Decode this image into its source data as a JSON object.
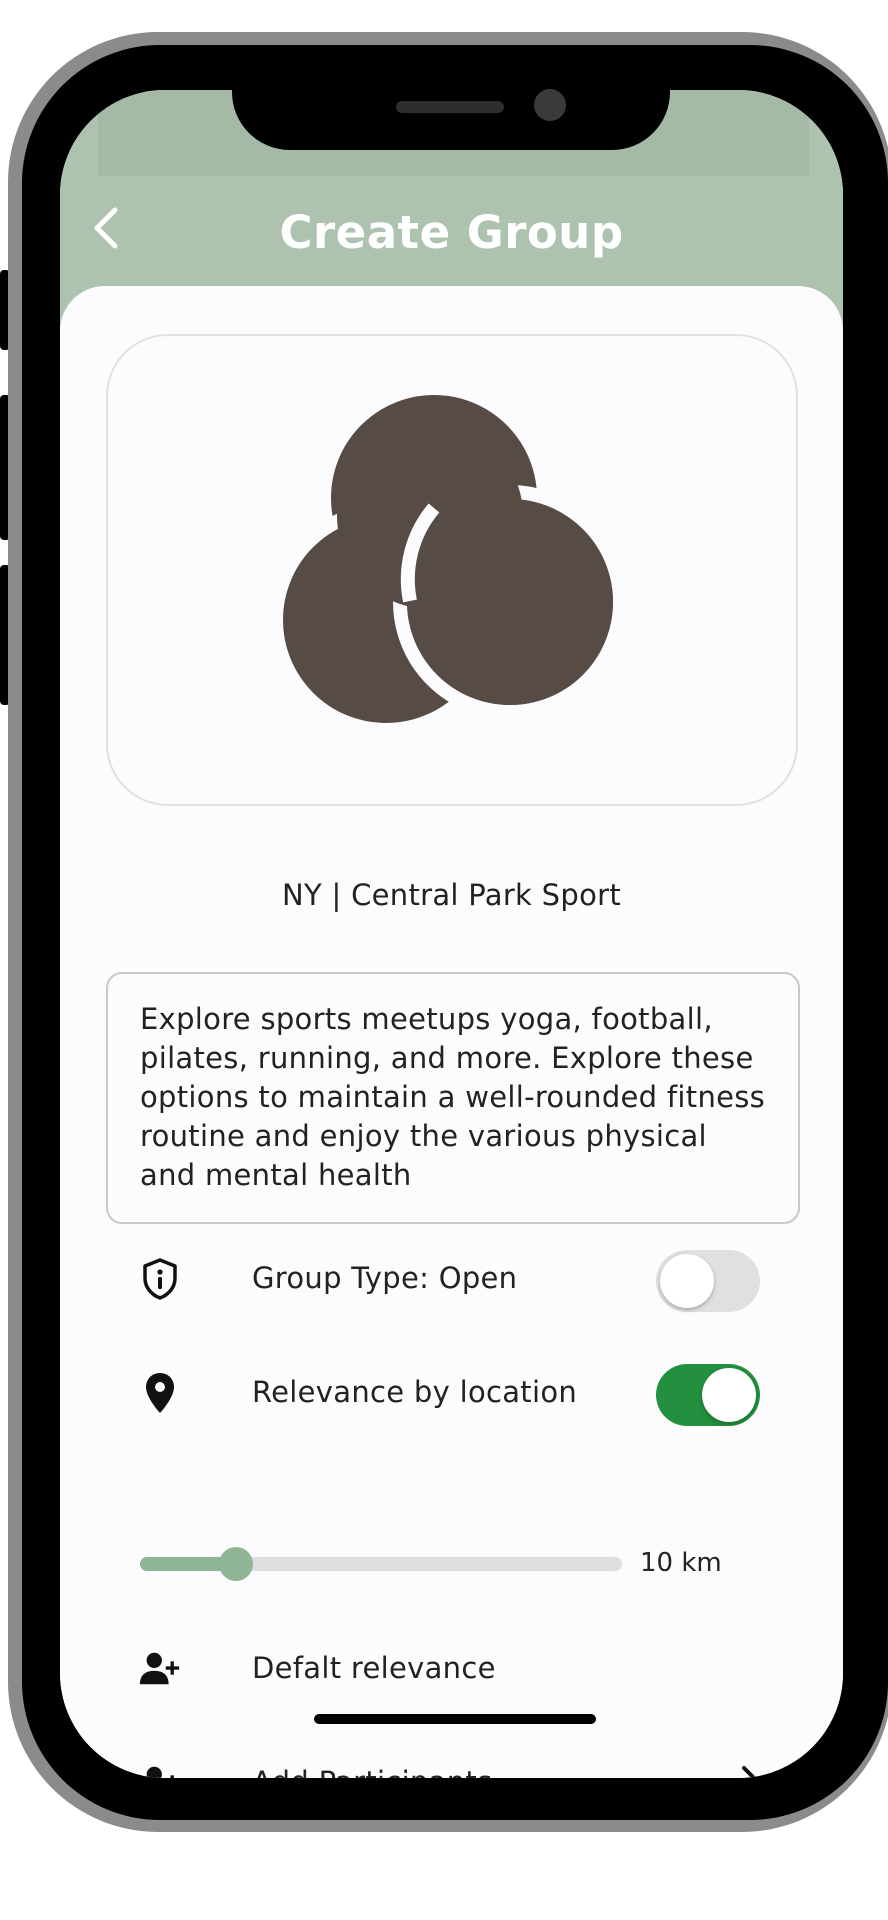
{
  "header": {
    "title": "Create Group",
    "back_icon": "chevron-left-icon",
    "background_color": "#aec2b0"
  },
  "group": {
    "logo_icon": "three-circles-logo-icon",
    "logo_color": "#564c45",
    "name": "NY | Central Park Sport",
    "description": "Explore sports meetups yoga, football, pilates, running, and more. Explore these options to maintain a well-rounded fitness routine and enjoy the various physical and mental health"
  },
  "settings": {
    "group_type": {
      "label": "Group Type: Open",
      "icon": "shield-info-icon",
      "enabled": false
    },
    "relevance_by_location": {
      "label": "Relevance by location",
      "icon": "location-pin-icon",
      "enabled": true,
      "accent_color": "#22903e"
    },
    "distance_slider": {
      "value_label": "10 km",
      "fraction": 0.2,
      "accent_color": "#8fb596"
    },
    "default_relevance": {
      "label": "Defalt relevance",
      "icon": "add-person-icon"
    },
    "add_participants": {
      "label": "Add Participants",
      "icon": "add-person-icon",
      "chevron_icon": "chevron-right-icon"
    }
  }
}
